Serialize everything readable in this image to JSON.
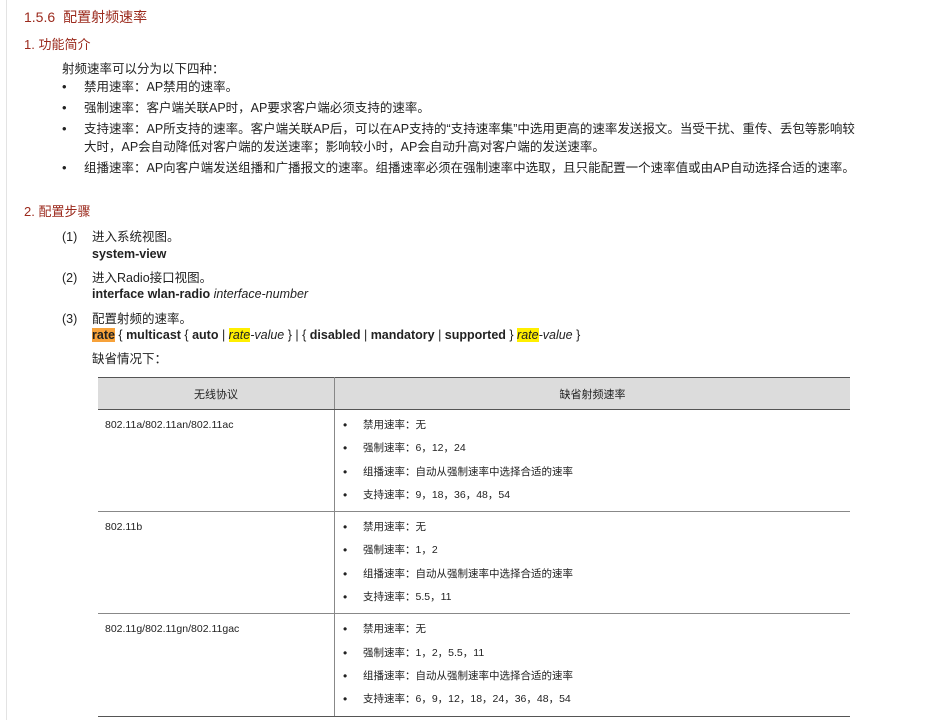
{
  "section": {
    "number": "1.5.6",
    "title": "配置射频速率"
  },
  "subsection1": {
    "heading": "1. 功能简介",
    "intro": "射频速率可以分为以下四种：",
    "bullets": [
      "禁用速率：AP禁用的速率。",
      "强制速率：客户端关联AP时，AP要求客户端必须支持的速率。",
      "支持速率：AP所支持的速率。客户端关联AP后，可以在AP支持的“支持速率集”中选用更高的速率发送报文。当受干扰、重传、丢包等影响较大时，AP会自动降低对客户端的发送速率；影响较小时，AP会自动升高对客户端的发送速率。",
      "组播速率：AP向客户端发送组播和广播报文的速率。组播速率必须在强制速率中选取，且只能配置一个速率值或由AP自动选择合适的速率。"
    ]
  },
  "subsection2": {
    "heading": "2. 配置步骤",
    "steps": [
      {
        "index": "(1)",
        "text": "进入系统视图。"
      },
      {
        "index": "(2)",
        "text": "进入Radio接口视图。"
      },
      {
        "index": "(3)",
        "text": "配置射频的速率。"
      }
    ],
    "cmd1": {
      "keyword": "system-view"
    },
    "cmd2": {
      "keyword": "interface wlan-radio",
      "arg": "interface-number"
    },
    "cmd3": {
      "kw_rate": "rate",
      "t1": " { ",
      "kw_multicast": "multicast",
      "t2": " { ",
      "kw_auto": "auto",
      "t3": " | ",
      "arg_rate_hl": "rate",
      "arg_value": "-value",
      "t4": " } | { ",
      "kw_disabled": "disabled",
      "t5": " | ",
      "kw_mandatory": "mandatory",
      "t6": " | ",
      "kw_supported": "supported",
      "t7": " } ",
      "arg2_rate_hl": "rate",
      "arg2_value": "-value",
      "t8": " }"
    },
    "default_note": "缺省情况下："
  },
  "table": {
    "headers": [
      "无线协议",
      "缺省射频速率"
    ],
    "rows": [
      {
        "protocol": "802.11a/802.11an/802.11ac",
        "values": [
          "禁用速率：无",
          "强制速率：6，12，24",
          "组播速率：自动从强制速率中选择合适的速率",
          "支持速率：9，18，36，48，54"
        ]
      },
      {
        "protocol": "802.11b",
        "values": [
          "禁用速率：无",
          "强制速率：1，2",
          "组播速率：自动从强制速率中选择合适的速率",
          "支持速率：5.5，11"
        ]
      },
      {
        "protocol": "802.11g/802.11gn/802.11gac",
        "values": [
          "禁用速率：无",
          "强制速率：1，2，5.5，11",
          "组播速率：自动从强制速率中选择合适的速率",
          "支持速率：6，9，12，18，24，36，48，54"
        ]
      }
    ]
  }
}
